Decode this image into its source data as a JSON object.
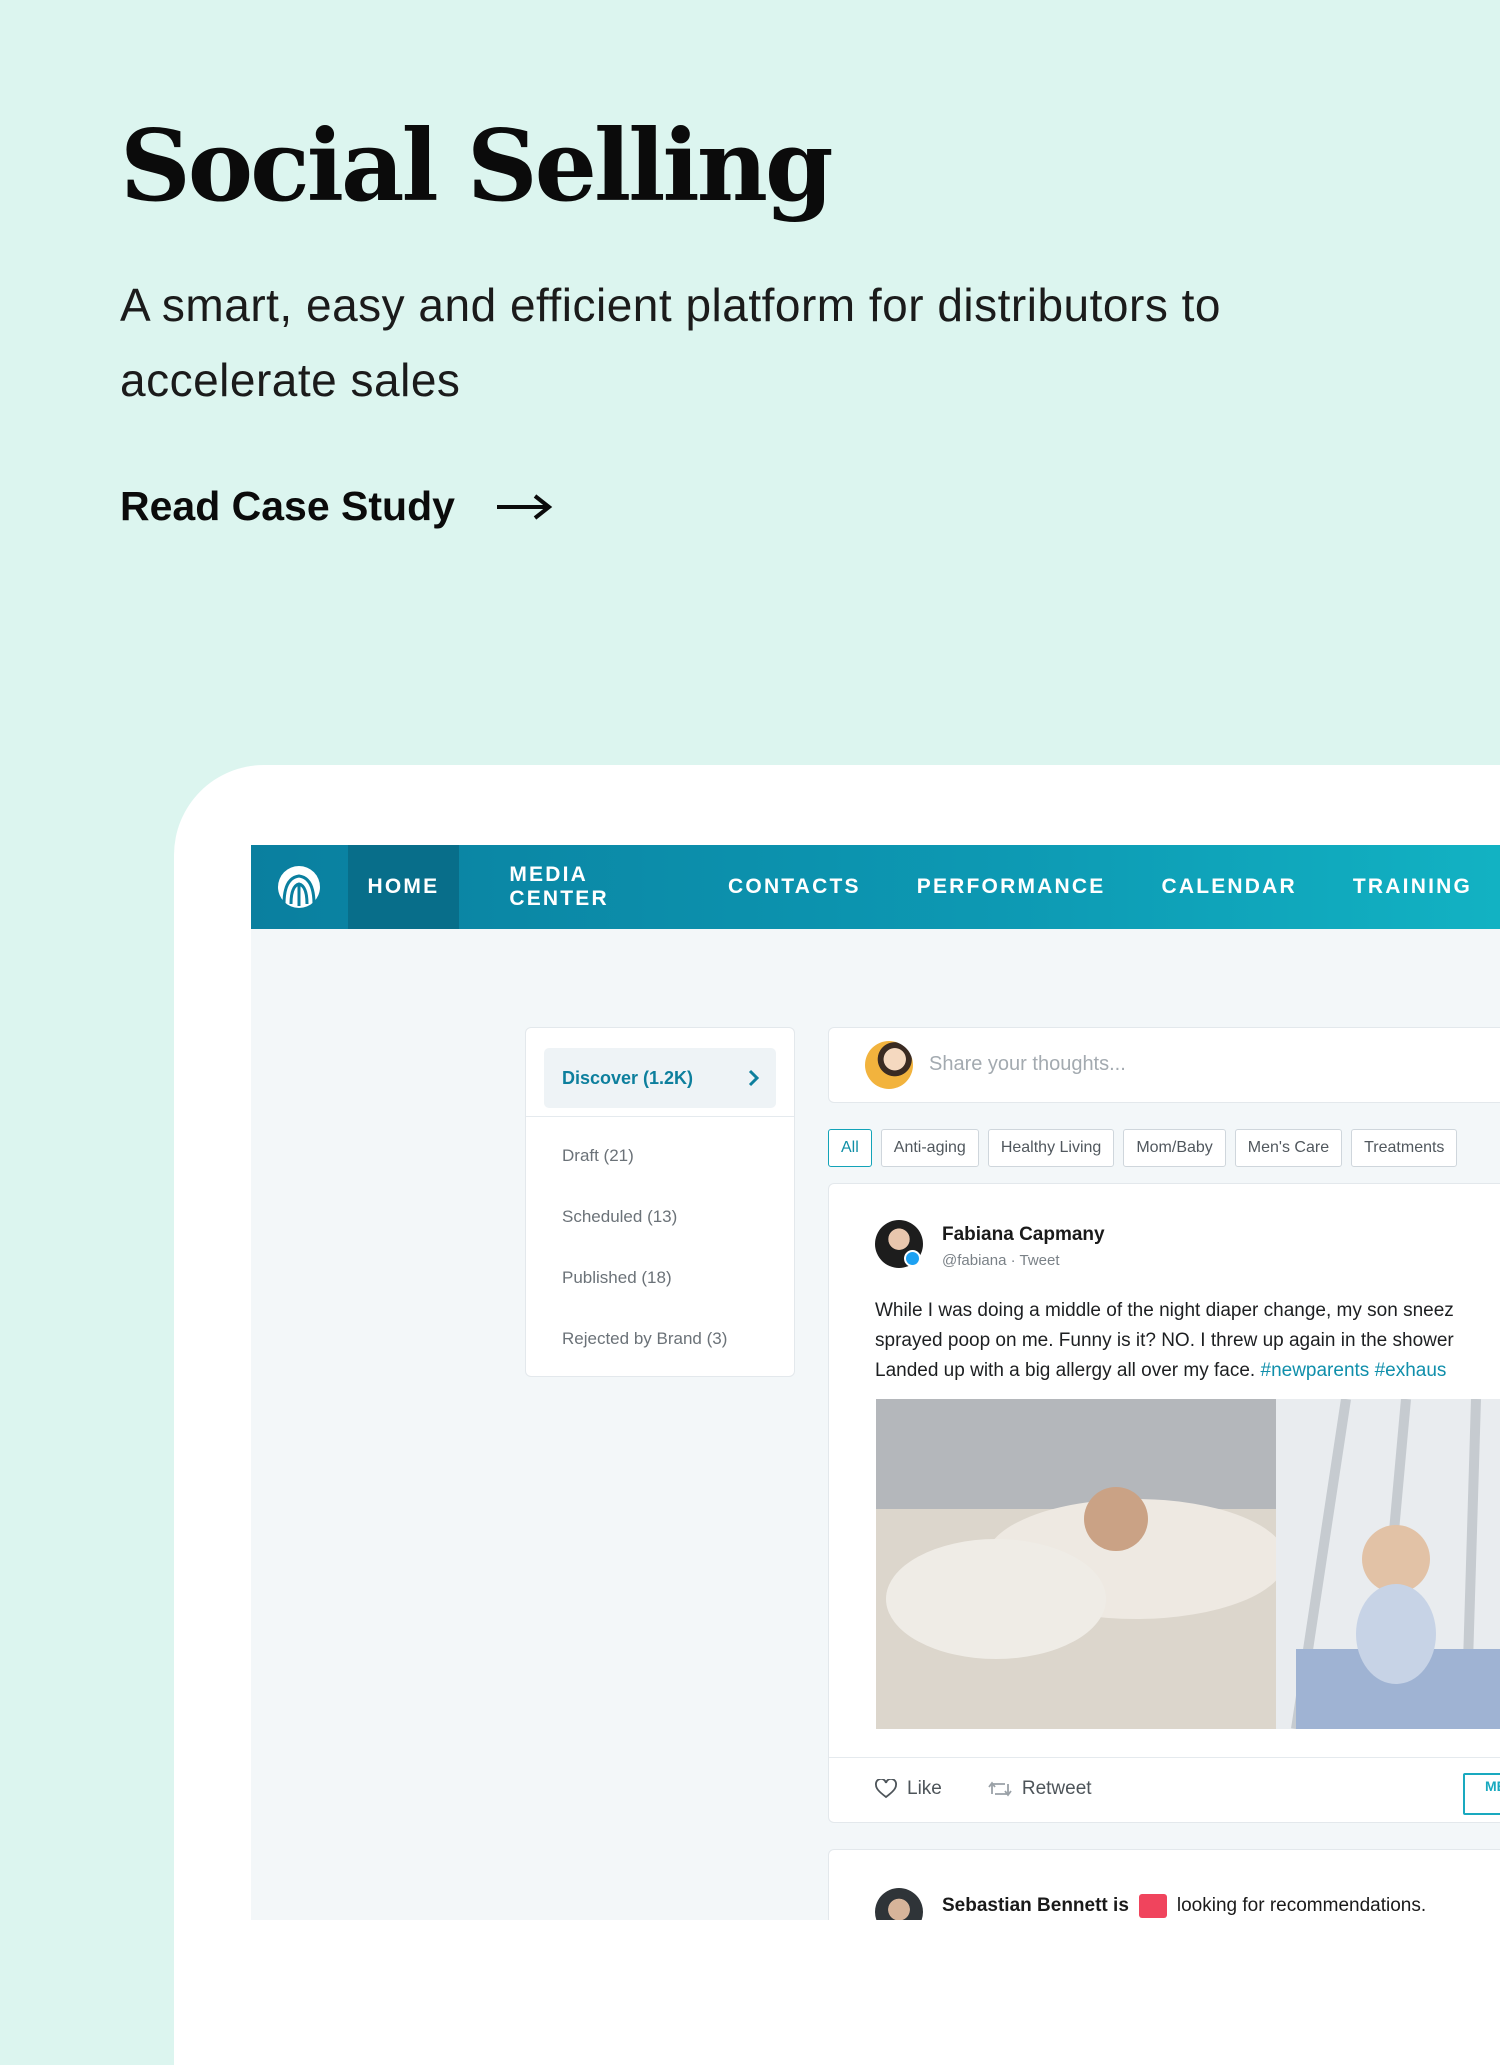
{
  "hero": {
    "title": "Social Selling",
    "subtitle": "A smart, easy and efficient platform for distributors to accelerate sales",
    "cta_label": "Read Case Study"
  },
  "colors": {
    "page_background": "#dcf5ef",
    "nav_start": "#0a7f9f",
    "nav_end": "#12b2c3",
    "accent": "#0d7f9d",
    "hashtag": "#108fab"
  },
  "app": {
    "nav": {
      "logo_icon": "brand-logo-icon",
      "items": [
        {
          "label": "HOME",
          "active": true
        },
        {
          "label": "MEDIA CENTER",
          "active": false
        },
        {
          "label": "CONTACTS",
          "active": false
        },
        {
          "label": "PERFORMANCE",
          "active": false
        },
        {
          "label": "CALENDAR",
          "active": false
        },
        {
          "label": "TRAINING",
          "active": false
        }
      ]
    },
    "sidebar": {
      "discover_label": "Discover (1.2K)",
      "items": [
        {
          "label": "Draft (21)"
        },
        {
          "label": "Scheduled (13)"
        },
        {
          "label": "Published (18)"
        },
        {
          "label": "Rejected by Brand (3)"
        }
      ]
    },
    "composer": {
      "placeholder": "Share your thoughts..."
    },
    "filters": [
      "All",
      "Anti-aging",
      "Healthy Living",
      "Mom/Baby",
      "Men's Care",
      "Treatments"
    ],
    "post": {
      "author": "Fabiana Capmany",
      "handle": "@fabiana · Tweet",
      "text_lines": [
        "While I was doing a middle of the night diaper change, my son sneez",
        "sprayed poop on me. Funny is it? NO. I threw up again in the shower",
        "Landed up with a big allergy all over my face."
      ],
      "hashtags": "#newparents #exhaus",
      "like_label": "Like",
      "retweet_label": "Retweet",
      "more_label": "ME E"
    },
    "post2": {
      "author": "Sebastian Bennett is",
      "suffix": "looking for recommendations."
    }
  }
}
